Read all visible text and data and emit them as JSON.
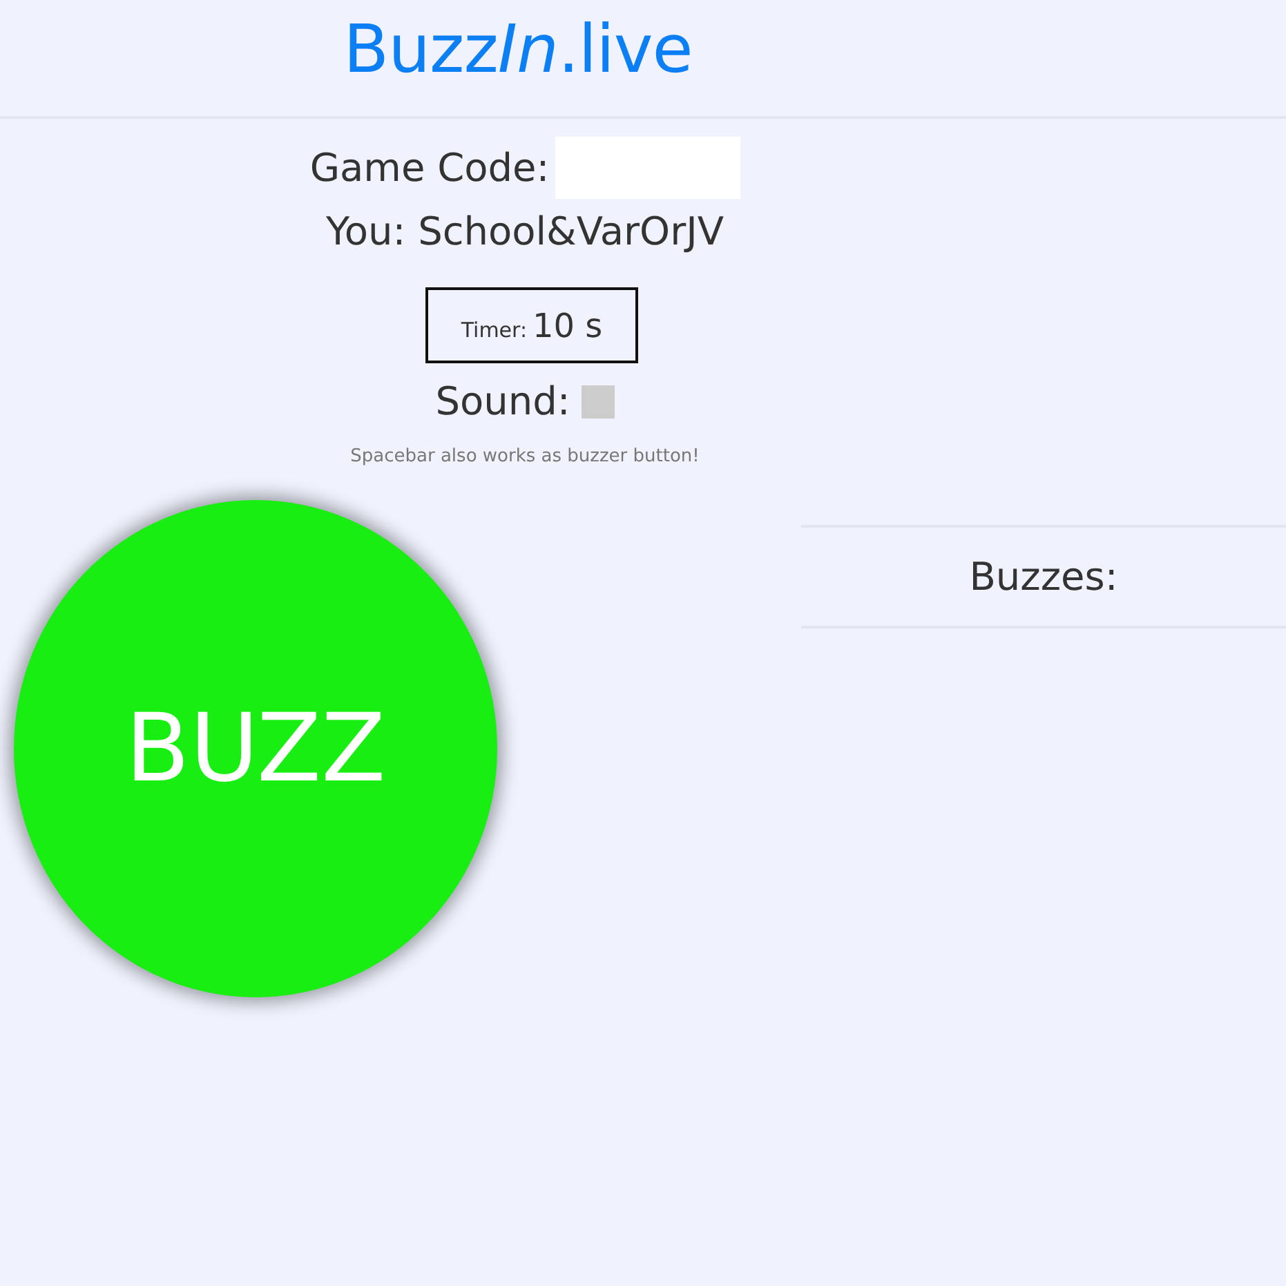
{
  "header": {
    "title_parts": [
      {
        "text": "Buzz",
        "italic": false
      },
      {
        "text": "In",
        "italic": true
      },
      {
        "text": ".live",
        "italic": false
      }
    ]
  },
  "game_code": {
    "label": "Game Code:"
  },
  "player": {
    "text": "You: School&VarOrJV"
  },
  "timer": {
    "label": "Timer:",
    "value": "10 s"
  },
  "sound": {
    "label": "Sound:",
    "checked": false
  },
  "hint": "Spacebar also works as buzzer button!",
  "buzz_button": {
    "label": "BUZZ"
  },
  "buzzes": {
    "title": "Buzzes:"
  }
}
